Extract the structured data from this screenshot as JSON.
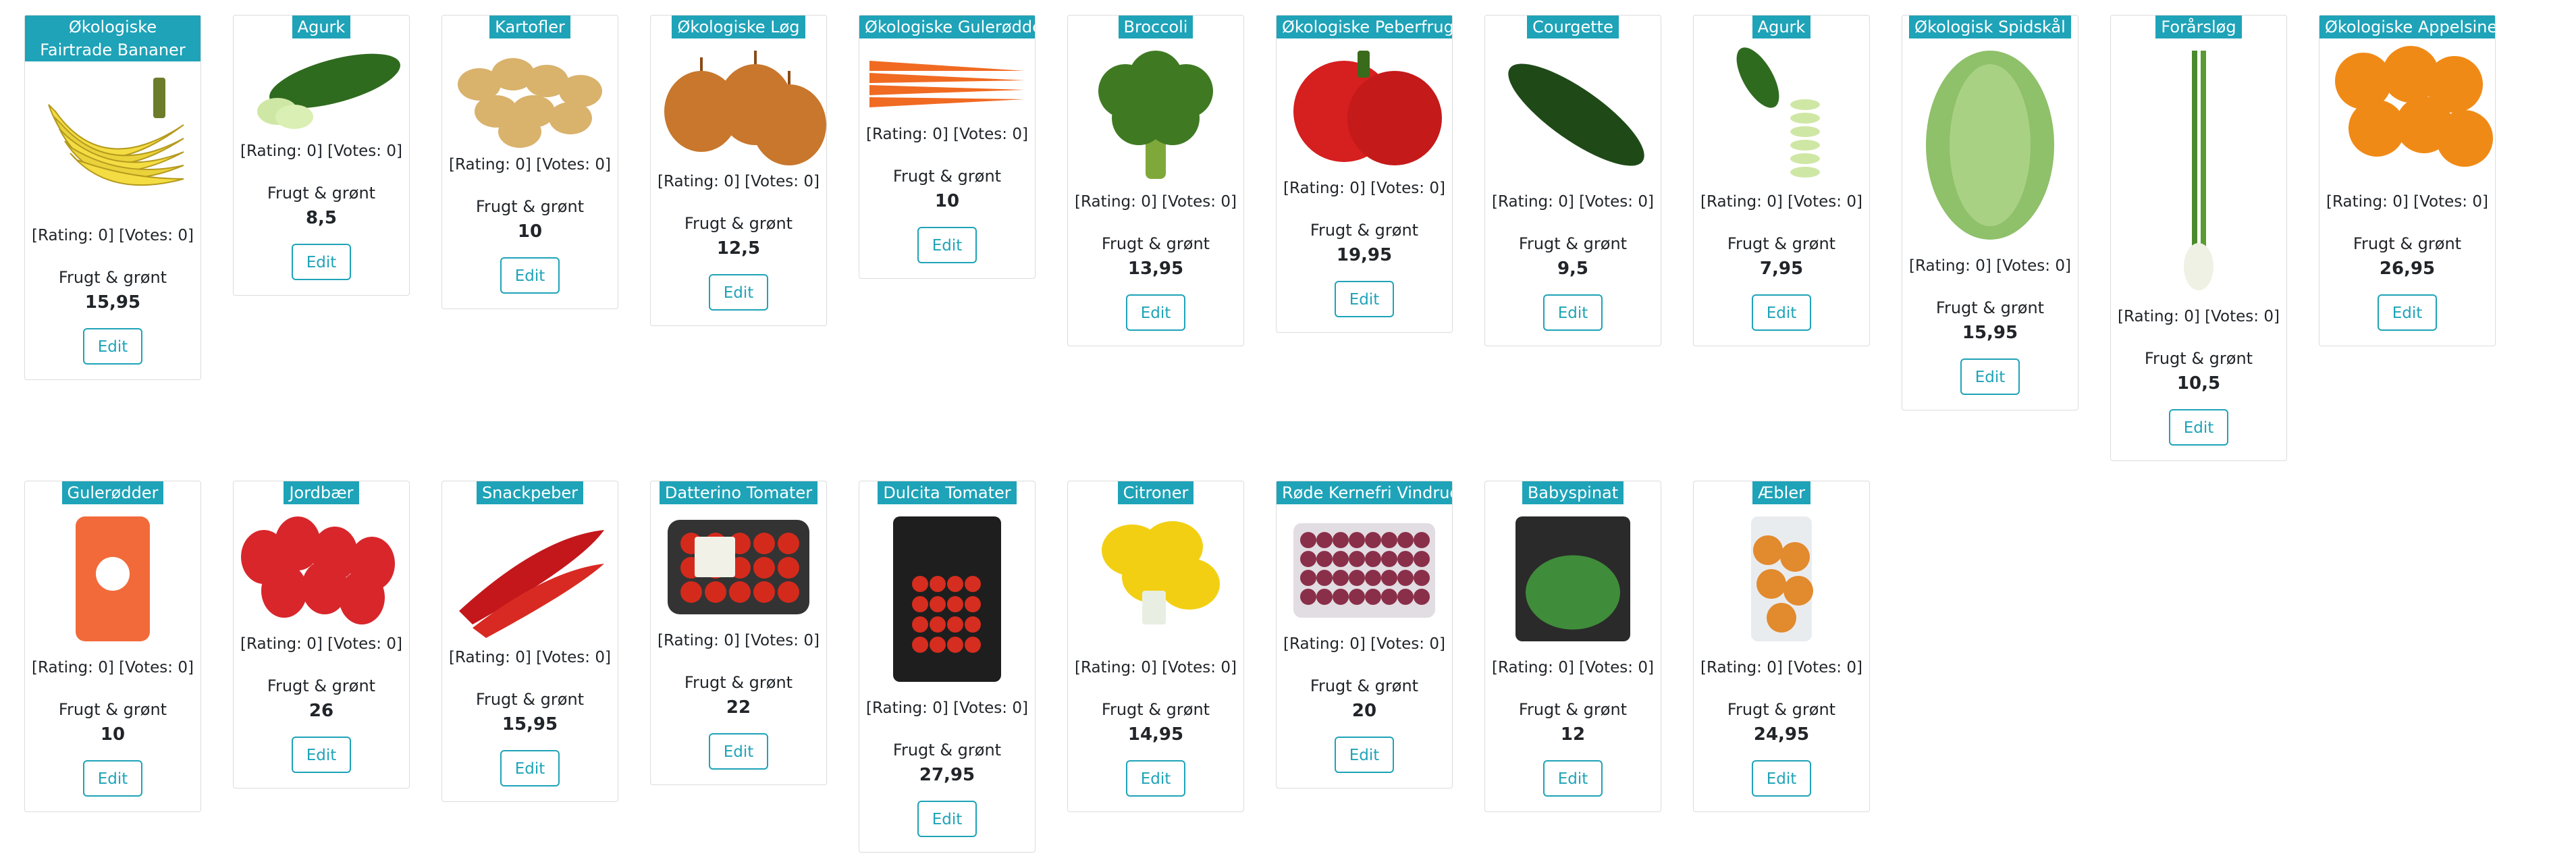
{
  "page": {
    "accent": "#1ea3b8"
  },
  "cards": [
    {
      "name": "Økologiske Fairtrade Bananer",
      "rating": "[Rating: 0] [Votes: 0]",
      "category": "Frugt & grønt",
      "price": "15,95",
      "edit": "Edit",
      "image": "banana-image"
    },
    {
      "name": "Agurk",
      "rating": "[Rating: 0] [Votes: 0]",
      "category": "Frugt & grønt",
      "price": "8,5",
      "edit": "Edit",
      "image": "cucumber-image"
    },
    {
      "name": "Kartofler",
      "rating": "[Rating: 0] [Votes: 0]",
      "category": "Frugt & grønt",
      "price": "10",
      "edit": "Edit",
      "image": "potatoes-image"
    },
    {
      "name": "Økologiske Løg",
      "rating": "[Rating: 0] [Votes: 0]",
      "category": "Frugt & grønt",
      "price": "12,5",
      "edit": "Edit",
      "image": "onions-image"
    },
    {
      "name": "Økologiske Gulerødder",
      "rating": "[Rating: 0] [Votes: 0]",
      "category": "Frugt & grønt",
      "price": "10",
      "edit": "Edit",
      "image": "carrots-image"
    },
    {
      "name": "Broccoli",
      "rating": "[Rating: 0] [Votes: 0]",
      "category": "Frugt & grønt",
      "price": "13,95",
      "edit": "Edit",
      "image": "broccoli-image"
    },
    {
      "name": "Økologiske Peberfrugter",
      "rating": "[Rating: 0] [Votes: 0]",
      "category": "Frugt & grønt",
      "price": "19,95",
      "edit": "Edit",
      "image": "bell-pepper-image"
    },
    {
      "name": "Courgette",
      "rating": "[Rating: 0] [Votes: 0]",
      "category": "Frugt & grønt",
      "price": "9,5",
      "edit": "Edit",
      "image": "zucchini-image"
    },
    {
      "name": "Agurk",
      "rating": "[Rating: 0] [Votes: 0]",
      "category": "Frugt & grønt",
      "price": "7,95",
      "edit": "Edit",
      "image": "cucumber-slices-image"
    },
    {
      "name": "Økologisk Spidskål",
      "rating": "[Rating: 0] [Votes: 0]",
      "category": "Frugt & grønt",
      "price": "15,95",
      "edit": "Edit",
      "image": "cabbage-image"
    },
    {
      "name": "Forårsløg",
      "rating": "[Rating: 0] [Votes: 0]",
      "category": "Frugt & grønt",
      "price": "10,5",
      "edit": "Edit",
      "image": "spring-onion-image"
    },
    {
      "name": "Økologiske Appelsiner",
      "rating": "[Rating: 0] [Votes: 0]",
      "category": "Frugt & grønt",
      "price": "26,95",
      "edit": "Edit",
      "image": "oranges-image"
    },
    {
      "name": "Gulerødder",
      "rating": "[Rating: 0] [Votes: 0]",
      "category": "Frugt & grønt",
      "price": "10",
      "edit": "Edit",
      "image": "carrot-bag-image"
    },
    {
      "name": "Jordbær",
      "rating": "[Rating: 0] [Votes: 0]",
      "category": "Frugt & grønt",
      "price": "26",
      "edit": "Edit",
      "image": "strawberries-image"
    },
    {
      "name": "Snackpeber",
      "rating": "[Rating: 0] [Votes: 0]",
      "category": "Frugt & grønt",
      "price": "15,95",
      "edit": "Edit",
      "image": "snack-pepper-image"
    },
    {
      "name": "Datterino Tomater",
      "rating": "[Rating: 0] [Votes: 0]",
      "category": "Frugt & grønt",
      "price": "22",
      "edit": "Edit",
      "image": "tomato-tray-image"
    },
    {
      "name": "Dulcita Tomater",
      "rating": "[Rating: 0] [Votes: 0]",
      "category": "Frugt & grønt",
      "price": "27,95",
      "edit": "Edit",
      "image": "tomato-bag-image"
    },
    {
      "name": "Citroner",
      "rating": "[Rating: 0] [Votes: 0]",
      "category": "Frugt & grønt",
      "price": "14,95",
      "edit": "Edit",
      "image": "lemons-image"
    },
    {
      "name": "Røde Kernefri Vindruer",
      "rating": "[Rating: 0] [Votes: 0]",
      "category": "Frugt & grønt",
      "price": "20",
      "edit": "Edit",
      "image": "grapes-image"
    },
    {
      "name": "Babyspinat",
      "rating": "[Rating: 0] [Votes: 0]",
      "category": "Frugt & grønt",
      "price": "12",
      "edit": "Edit",
      "image": "spinach-bag-image"
    },
    {
      "name": "Æbler",
      "rating": "[Rating: 0] [Votes: 0]",
      "category": "Frugt & grønt",
      "price": "24,95",
      "edit": "Edit",
      "image": "apples-bag-image"
    }
  ]
}
